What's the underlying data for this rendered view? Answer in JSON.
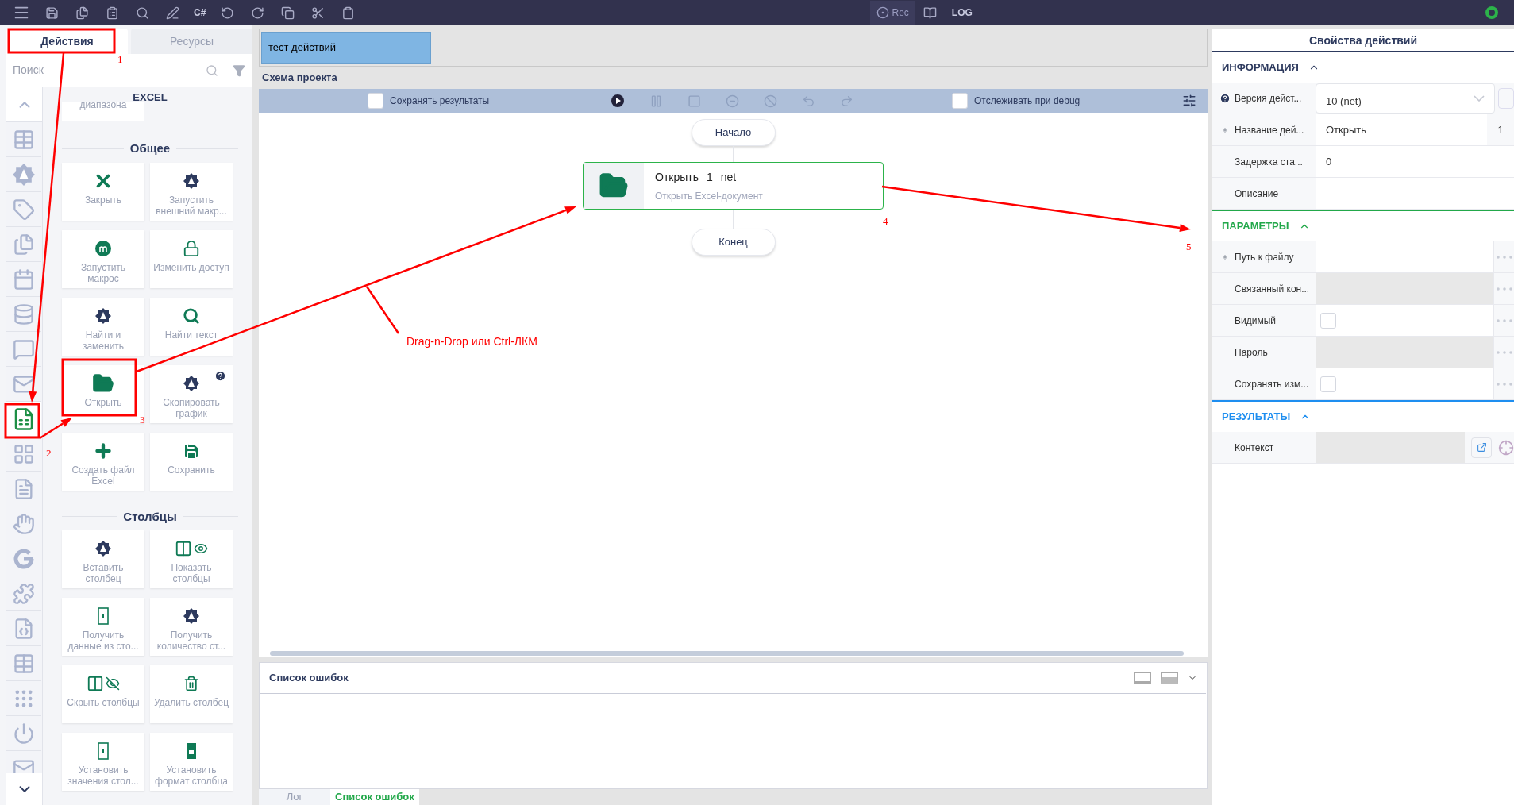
{
  "top_bar": [
    {
      "kind": "menu"
    },
    {
      "kind": "save"
    },
    {
      "kind": "save-copy"
    },
    {
      "kind": "clipboard-list"
    },
    {
      "kind": "search"
    },
    {
      "kind": "edit-list"
    },
    {
      "kind": "text",
      "label": "C#"
    },
    {
      "kind": "undo"
    },
    {
      "kind": "redo"
    },
    {
      "kind": "copy"
    },
    {
      "kind": "cut"
    },
    {
      "kind": "paste"
    },
    {
      "kind": "rec",
      "label": "Rec"
    },
    {
      "kind": "book"
    },
    {
      "kind": "text",
      "label": "LOG"
    },
    {
      "kind": "status"
    }
  ],
  "left_tabs": [
    {
      "label": "Действия",
      "selected": true
    },
    {
      "label": "Ресурсы",
      "selected": false
    }
  ],
  "search": {
    "placeholder": "Поиск"
  },
  "category_icons": [
    {
      "kind": "table",
      "selected": false
    },
    {
      "kind": "badge",
      "selected": false
    },
    {
      "kind": "tag",
      "selected": false
    },
    {
      "kind": "copy",
      "selected": false
    },
    {
      "kind": "calendar",
      "selected": false
    },
    {
      "kind": "database",
      "selected": false
    },
    {
      "kind": "message",
      "selected": false
    },
    {
      "kind": "mail",
      "selected": false
    },
    {
      "kind": "excel",
      "selected": true
    },
    {
      "kind": "grid",
      "selected": false
    },
    {
      "kind": "document",
      "selected": false
    },
    {
      "kind": "hand",
      "selected": false
    },
    {
      "kind": "google",
      "selected": false
    },
    {
      "kind": "puzzle",
      "selected": false
    },
    {
      "kind": "json",
      "selected": false
    },
    {
      "kind": "table",
      "selected": false
    },
    {
      "kind": "dots",
      "selected": false
    },
    {
      "kind": "power",
      "selected": false
    },
    {
      "kind": "mail",
      "selected": false
    }
  ],
  "actions": {
    "header": "EXCEL",
    "partial_card": "диапазона",
    "sections": [
      {
        "title": "Общее",
        "cards": [
          {
            "label": "Закрыть",
            "kind": "close",
            "help": false
          },
          {
            "label": "Запустить внешний макр...",
            "kind": "badge",
            "help": false
          },
          {
            "label": "Запустить макрос",
            "kind": "macro",
            "help": false
          },
          {
            "label": "Изменить доступ",
            "kind": "lock",
            "help": false
          },
          {
            "label": "Найти и заменить",
            "kind": "badge",
            "help": false
          },
          {
            "label": "Найти текст",
            "kind": "search",
            "help": false
          },
          {
            "label": "Открыть",
            "kind": "folder",
            "help": false
          },
          {
            "label": "Скопировать график",
            "kind": "badge",
            "help": true
          },
          {
            "label": "Создать файл Excel",
            "kind": "plus",
            "help": false
          },
          {
            "label": "Сохранить",
            "kind": "save",
            "help": false
          }
        ]
      },
      {
        "title": "Столбцы",
        "cards": [
          {
            "label": "Вставить столбец",
            "kind": "badge",
            "help": false
          },
          {
            "label": "Показать столбцы",
            "kind": "show-columns",
            "help": false
          },
          {
            "label": "Получить данные из сто...",
            "kind": "column",
            "help": false
          },
          {
            "label": "Получить количество ст...",
            "kind": "badge",
            "help": false
          },
          {
            "label": "Скрыть столбцы",
            "kind": "hide-columns",
            "help": false
          },
          {
            "label": "Удалить столбец",
            "kind": "column-delete",
            "help": false
          },
          {
            "label": "Установить значения стол...",
            "kind": "column",
            "help": false
          },
          {
            "label": "Установить формат столбца",
            "kind": "column-format",
            "help": false
          }
        ]
      }
    ]
  },
  "document_tabs": [
    {
      "label": "тест действий",
      "selected": true
    }
  ],
  "schema": {
    "title": "Схема проекта",
    "options": [
      {
        "label": "Сохранять результаты",
        "checked": false
      },
      {
        "label": "Отслеживать при debug",
        "checked": false
      }
    ],
    "controls": [
      {
        "kind": "play",
        "disabled": false
      },
      {
        "kind": "pause",
        "disabled": true
      },
      {
        "kind": "stop",
        "disabled": true
      },
      {
        "kind": "minus",
        "disabled": true
      },
      {
        "kind": "ban",
        "disabled": true
      },
      {
        "kind": "undo",
        "disabled": true
      },
      {
        "kind": "redo",
        "disabled": true
      }
    ],
    "start": "Начало",
    "end": "Конец",
    "block": {
      "name": "Открыть",
      "number": "1",
      "tag": "net",
      "subtitle": "Открыть Excel-документ"
    }
  },
  "errors_panel": {
    "title": "Список ошибок"
  },
  "bottom_tabs": [
    {
      "label": "Лог",
      "selected": false
    },
    {
      "label": "Список ошибок",
      "selected": true
    }
  ],
  "properties": {
    "title": "Свойства действий",
    "sections": [
      {
        "title": "ИНФОРМАЦИЯ",
        "color": "#2d3a5e",
        "rows": [
          {
            "label": "Версия дейст...",
            "kind": "select",
            "value": "10 (net)",
            "help": true,
            "required": false
          },
          {
            "label": "Название дей...",
            "kind": "text",
            "value": "Открыть",
            "suffix": "1",
            "help": false,
            "required": true
          },
          {
            "label": "Задержка ста...",
            "kind": "text",
            "value": "0",
            "help": false,
            "required": false
          },
          {
            "label": "Описание",
            "kind": "text",
            "help": false,
            "required": false
          }
        ]
      },
      {
        "title": "ПАРАМЕТРЫ",
        "color": "#22a84a",
        "rows": [
          {
            "label": "Путь к файлу",
            "kind": "text",
            "help": false,
            "required": true,
            "more": true
          },
          {
            "label": "Связанный кон...",
            "kind": "disabled",
            "help": false,
            "required": false,
            "more": true
          },
          {
            "label": "Видимый",
            "kind": "checkbox",
            "checked": false,
            "help": false,
            "required": false,
            "more": true
          },
          {
            "label": "Пароль",
            "kind": "disabled",
            "help": false,
            "required": false,
            "more": true
          },
          {
            "label": "Сохранять изм...",
            "kind": "checkbox",
            "checked": false,
            "help": false,
            "required": false,
            "more": true
          }
        ]
      },
      {
        "title": "РЕЗУЛЬТАТЫ",
        "color": "#1e8ef0",
        "rows": [
          {
            "label": "Контекст",
            "kind": "result",
            "help": false,
            "required": false
          }
        ]
      }
    ]
  },
  "annotations": {
    "steps": [
      "1",
      "2",
      "3",
      "4",
      "5"
    ],
    "caption": "Drag-n-Drop или Ctrl-ЛКМ"
  }
}
